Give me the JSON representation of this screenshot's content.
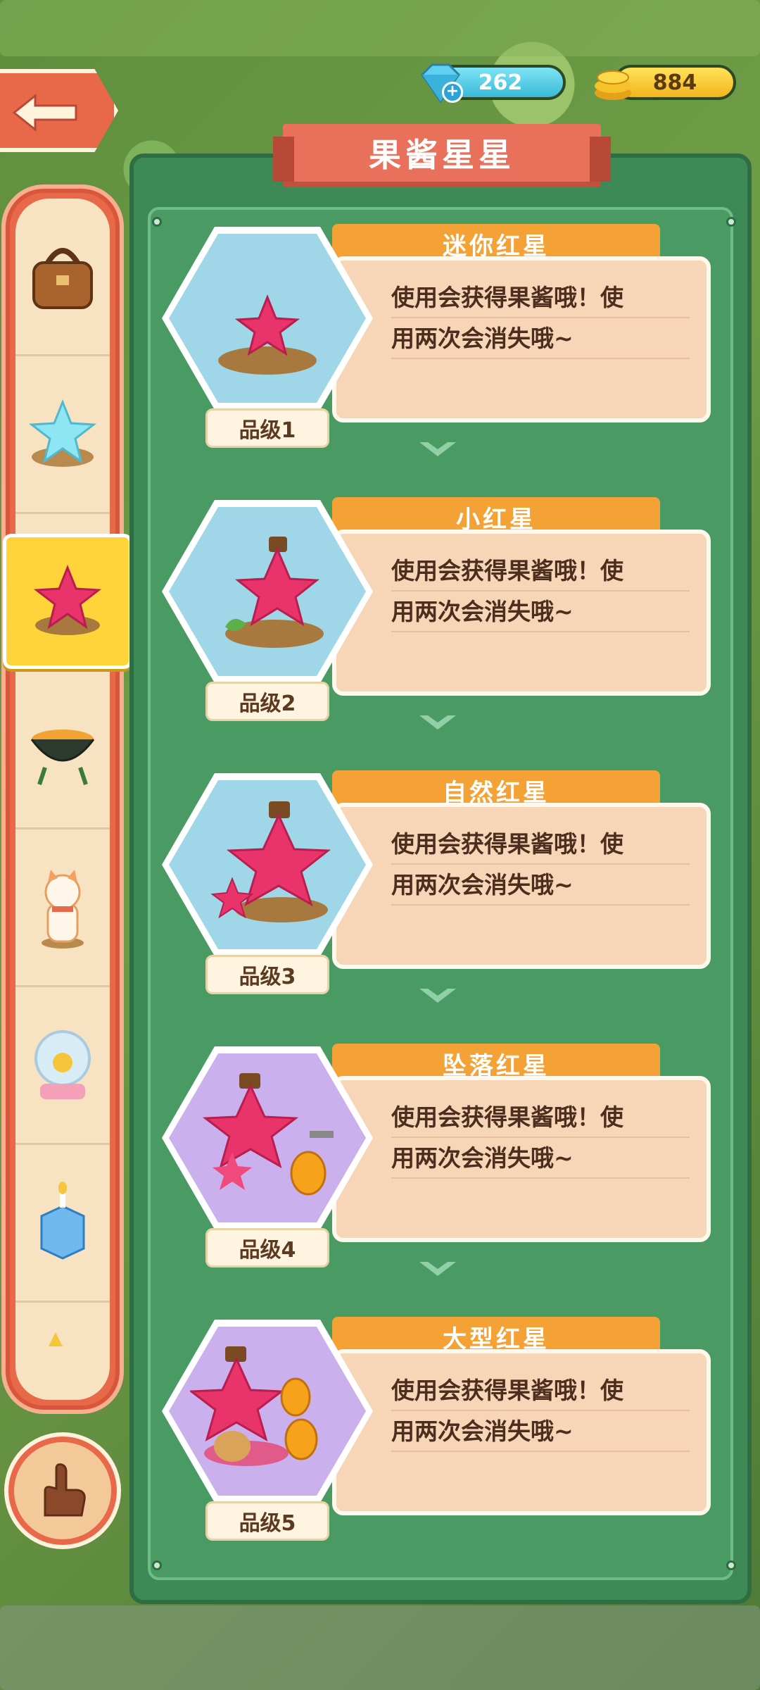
{
  "header": {
    "title": "果酱星星",
    "gems": "262",
    "coins": "884"
  },
  "sidebar": {
    "items": [
      {
        "icon": "bag-icon"
      },
      {
        "icon": "blue-star-icon"
      },
      {
        "icon": "red-star-icon",
        "selected": true
      },
      {
        "icon": "grill-icon"
      },
      {
        "icon": "cat-figure-icon"
      },
      {
        "icon": "snow-globe-icon"
      },
      {
        "icon": "ice-cube-candle-icon"
      },
      {
        "icon": "partial-item-icon"
      }
    ]
  },
  "items": [
    {
      "name": "迷你红星",
      "desc_line1": "使用会获得果酱哦！使",
      "desc_line2": "用两次会消失哦~",
      "level": "品级1",
      "bg": "blue"
    },
    {
      "name": "小红星",
      "desc_line1": "使用会获得果酱哦！使",
      "desc_line2": "用两次会消失哦~",
      "level": "品级2",
      "bg": "blue"
    },
    {
      "name": "自然红星",
      "desc_line1": "使用会获得果酱哦！使",
      "desc_line2": "用两次会消失哦~",
      "level": "品级3",
      "bg": "blue"
    },
    {
      "name": "坠落红星",
      "desc_line1": "使用会获得果酱哦！使",
      "desc_line2": "用两次会消失哦~",
      "level": "品级4",
      "bg": "purple"
    },
    {
      "name": "大型红星",
      "desc_line1": "使用会获得果酱哦！使",
      "desc_line2": "用两次会消失哦~",
      "level": "品级5",
      "bg": "purple"
    }
  ],
  "colors": {
    "accent": "#e8684a",
    "panel": "#3e8a56",
    "tab": "#f4a235",
    "star": "#e8336b"
  }
}
